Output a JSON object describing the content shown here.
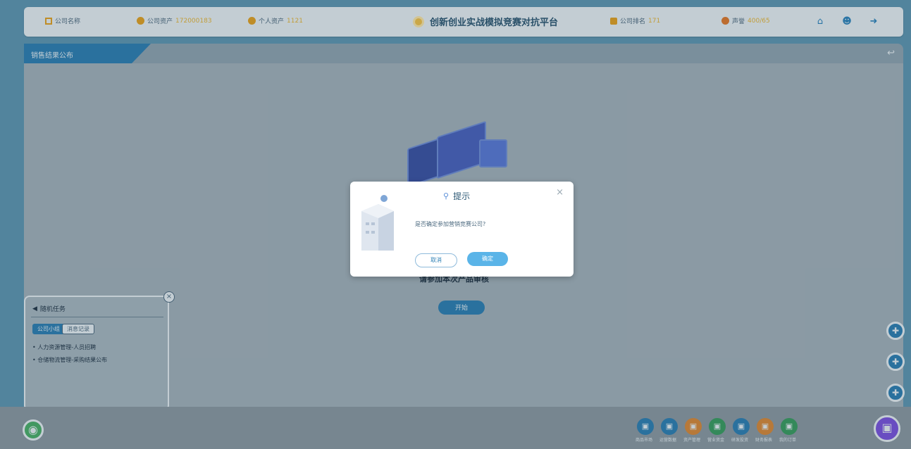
{
  "header": {
    "company_name": "公司名称",
    "company_assets_label": "公司资产",
    "company_assets_value": "172000183",
    "personal_assets_label": "个人资产",
    "personal_assets_value": "1121",
    "title": "创新创业实战模拟竞赛对抗平台",
    "company_rank_label": "公司排名",
    "company_rank_value": "171",
    "reputation_label": "声誉",
    "reputation_value": "400/65"
  },
  "section": {
    "label": "销售结果公布"
  },
  "main": {
    "start_text": "请参加本次产品审核",
    "start_button": "开始"
  },
  "task_panel": {
    "title": "随机任务",
    "tab_active": "公司小组",
    "tab_other": "消息记录",
    "items": [
      "人力资源管理-人员招聘",
      "仓储物流管理-采购结果公布"
    ]
  },
  "bottom_bar": {
    "items": [
      {
        "label": "商品市场",
        "color": "#2e80b5"
      },
      {
        "label": "运营数据",
        "color": "#2e80b5"
      },
      {
        "label": "资产管理",
        "color": "#d98a3a"
      },
      {
        "label": "营业资金",
        "color": "#3a9e62"
      },
      {
        "label": "研发投资",
        "color": "#2e80b5"
      },
      {
        "label": "财务报表",
        "color": "#d98a3a"
      },
      {
        "label": "我的订单",
        "color": "#3a9e62"
      }
    ]
  },
  "dialog": {
    "title": "提示",
    "message": "是否确定参加营销竞赛公司?",
    "cancel": "取消",
    "ok": "确定"
  }
}
